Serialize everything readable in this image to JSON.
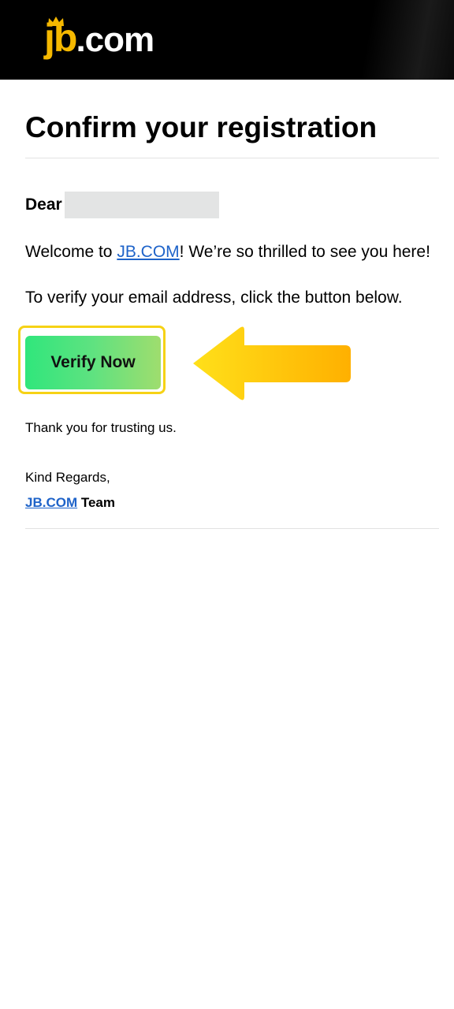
{
  "header": {
    "logo_brand": "jb",
    "logo_suffix": ".com"
  },
  "email": {
    "title": "Confirm your registration",
    "greeting": "Dear",
    "welcome_prefix": "Welcome to ",
    "welcome_link": "JB.COM",
    "welcome_suffix": "! We’re so thrilled to see you here!",
    "verify_instruction": "To verify your email address, click the button below.",
    "verify_button_label": "Verify Now",
    "thanks": "Thank you for trusting us.",
    "regards": "Kind Regards,",
    "signature_link": "JB.COM",
    "signature_suffix": " Team"
  },
  "colors": {
    "header_bg": "#000000",
    "brand_yellow": "#f5b800",
    "link_blue": "#1e63c9",
    "button_green": "#30e67c",
    "highlight_yellow": "#f6d215",
    "arrow_orange": "#ffb000"
  },
  "icons": {
    "logo_crown": "crown-icon",
    "pointer": "arrow-left-icon"
  }
}
